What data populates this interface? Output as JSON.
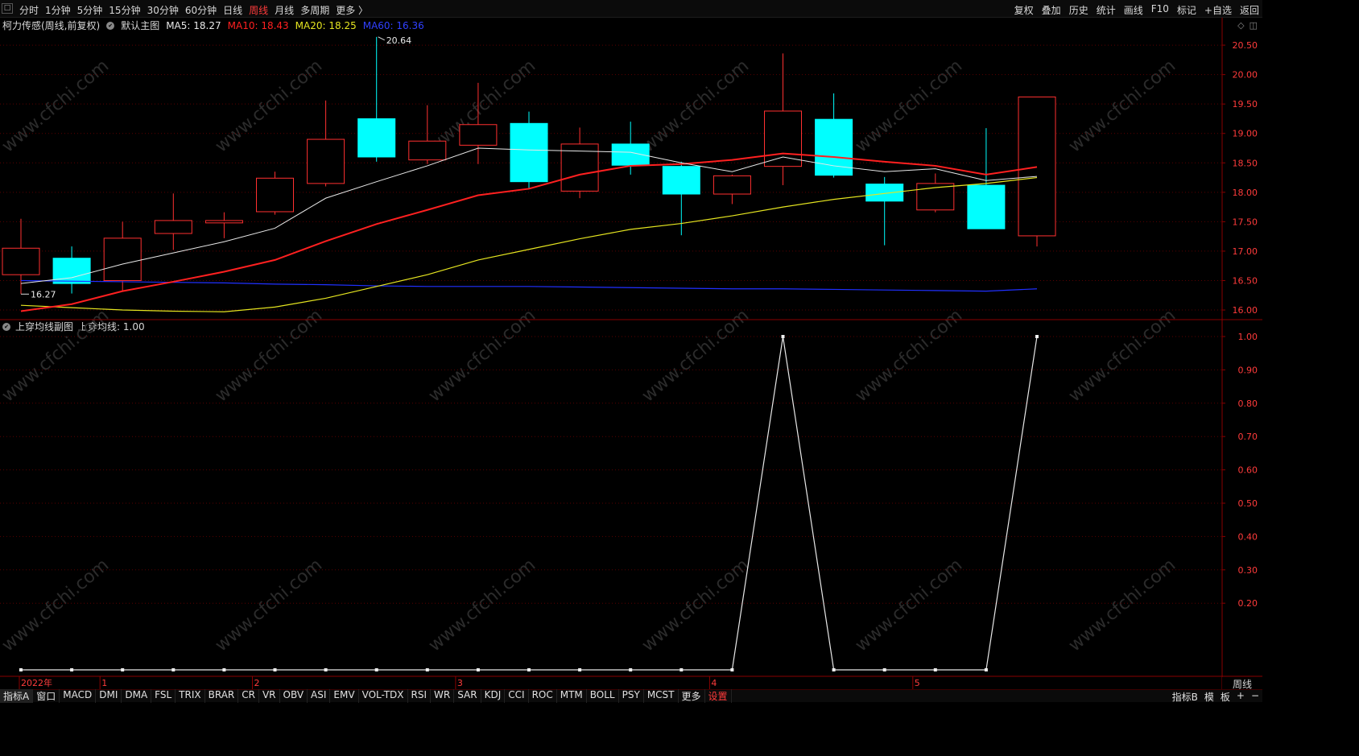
{
  "topbar": {
    "system_icon": "□",
    "periods": [
      "分时",
      "1分钟",
      "5分钟",
      "15分钟",
      "30分钟",
      "60分钟",
      "日线",
      "周线",
      "月线",
      "多周期",
      "更多 〉"
    ],
    "active_period": "周线",
    "tools": [
      "复权",
      "叠加",
      "历史",
      "统计",
      "画线",
      "F10",
      "标记",
      "+自选",
      "返回"
    ]
  },
  "main_info": {
    "stock": "柯力传感(周线,前复权)",
    "dot_glyph": "✔",
    "template": "默认主图",
    "ma5": "MA5: 18.27",
    "ma10": "MA10: 18.43",
    "ma20": "MA20: 18.25",
    "ma60": "MA60: 16.36",
    "right_icons": [
      "◇",
      "◫"
    ]
  },
  "sub_info": {
    "dot_glyph": "✔",
    "name": "上穿均线副图",
    "value": "上穿均线: 1.00"
  },
  "colors": {
    "up": "#ff3030",
    "down": "#00ffff",
    "ma5": "#e8e8e8",
    "ma10": "#ff2020",
    "ma20": "#e5e520",
    "ma60": "#2030ff",
    "grid": "#5a0000",
    "axis_text": "#ff3b3b"
  },
  "y_axis_main": [
    "20.50",
    "20.00",
    "19.50",
    "19.00",
    "18.50",
    "18.00",
    "17.50",
    "17.00",
    "16.50",
    "16.00"
  ],
  "y_axis_sub": [
    "1.00",
    "0.90",
    "0.80",
    "0.70",
    "0.60",
    "0.50",
    "0.40",
    "0.30",
    "0.20"
  ],
  "x_axis_labels": [
    {
      "text": "2022年",
      "bar": 0
    },
    {
      "text": "1",
      "bar": 2
    },
    {
      "text": "2",
      "bar": 5
    },
    {
      "text": "3",
      "bar": 9
    },
    {
      "text": "4",
      "bar": 14
    },
    {
      "text": "5",
      "bar": 18
    }
  ],
  "annotations": {
    "high": "20.64",
    "low": "16.27"
  },
  "chart_data": {
    "type": "candlestick",
    "candles": [
      {
        "o": 16.6,
        "c": 17.05,
        "h": 17.55,
        "l": 16.27
      },
      {
        "o": 16.88,
        "c": 16.45,
        "h": 17.08,
        "l": 16.28
      },
      {
        "o": 16.5,
        "c": 17.22,
        "h": 17.5,
        "l": 16.32
      },
      {
        "o": 17.3,
        "c": 17.52,
        "h": 17.98,
        "l": 17.02
      },
      {
        "o": 17.48,
        "c": 17.52,
        "h": 17.66,
        "l": 17.22
      },
      {
        "o": 17.67,
        "c": 18.24,
        "h": 18.35,
        "l": 17.62
      },
      {
        "o": 18.15,
        "c": 18.9,
        "h": 19.56,
        "l": 18.1
      },
      {
        "o": 19.25,
        "c": 18.6,
        "h": 20.64,
        "l": 18.52
      },
      {
        "o": 18.55,
        "c": 18.87,
        "h": 19.48,
        "l": 18.48
      },
      {
        "o": 18.8,
        "c": 19.15,
        "h": 19.86,
        "l": 18.48
      },
      {
        "o": 19.17,
        "c": 18.18,
        "h": 19.37,
        "l": 18.06
      },
      {
        "o": 18.02,
        "c": 18.82,
        "h": 19.1,
        "l": 17.9
      },
      {
        "o": 18.82,
        "c": 18.46,
        "h": 19.2,
        "l": 18.3
      },
      {
        "o": 18.44,
        "c": 17.97,
        "h": 18.52,
        "l": 17.27
      },
      {
        "o": 17.97,
        "c": 18.28,
        "h": 18.3,
        "l": 17.8
      },
      {
        "o": 18.44,
        "c": 19.38,
        "h": 20.36,
        "l": 18.12
      },
      {
        "o": 19.24,
        "c": 18.29,
        "h": 19.68,
        "l": 18.25
      },
      {
        "o": 18.14,
        "c": 17.85,
        "h": 18.26,
        "l": 17.1
      },
      {
        "o": 17.7,
        "c": 18.15,
        "h": 18.32,
        "l": 17.66
      },
      {
        "o": 18.12,
        "c": 17.38,
        "h": 19.09,
        "l": 17.38
      },
      {
        "o": 17.26,
        "c": 19.62,
        "h": 19.62,
        "l": 17.08
      }
    ],
    "ma5": [
      16.45,
      16.55,
      16.78,
      16.97,
      17.16,
      17.39,
      17.9,
      18.18,
      18.45,
      18.75,
      18.72,
      18.7,
      18.68,
      18.5,
      18.35,
      18.6,
      18.45,
      18.35,
      18.4,
      18.2,
      18.27
    ],
    "ma10": [
      15.98,
      16.1,
      16.32,
      16.48,
      16.65,
      16.85,
      17.17,
      17.46,
      17.7,
      17.95,
      18.06,
      18.3,
      18.45,
      18.48,
      18.55,
      18.66,
      18.6,
      18.52,
      18.45,
      18.3,
      18.43
    ],
    "ma20": [
      16.08,
      16.04,
      16.0,
      15.98,
      15.97,
      16.05,
      16.2,
      16.4,
      16.6,
      16.85,
      17.03,
      17.21,
      17.37,
      17.47,
      17.6,
      17.75,
      17.88,
      17.98,
      18.08,
      18.15,
      18.25
    ],
    "ma60": [
      16.5,
      16.49,
      16.48,
      16.47,
      16.46,
      16.44,
      16.43,
      16.41,
      16.4,
      16.4,
      16.4,
      16.39,
      16.38,
      16.37,
      16.36,
      16.36,
      16.35,
      16.34,
      16.33,
      16.32,
      16.36
    ],
    "signal": [
      0,
      0,
      0,
      0,
      0,
      0,
      0,
      0,
      0,
      0,
      0,
      0,
      0,
      0,
      0,
      1,
      0,
      0,
      0,
      0,
      1
    ],
    "ylim_main": [
      15.85,
      20.72
    ],
    "ylim_sub": [
      0,
      1
    ]
  },
  "bottombar": {
    "tabs": [
      "指标A",
      "窗口",
      "MACD",
      "DMI",
      "DMA",
      "FSL",
      "TRIX",
      "BRAR",
      "CR",
      "VR",
      "OBV",
      "ASI",
      "EMV",
      "VOL-TDX",
      "RSI",
      "WR",
      "SAR",
      "KDJ",
      "CCI",
      "ROC",
      "MTM",
      "BOLL",
      "PSY",
      "MCST",
      "更多",
      "设置"
    ],
    "right_tabs": [
      "指标B",
      "模",
      "板",
      "+",
      "−"
    ]
  },
  "period_label": "周线",
  "watermark": "www.cfchi.com"
}
